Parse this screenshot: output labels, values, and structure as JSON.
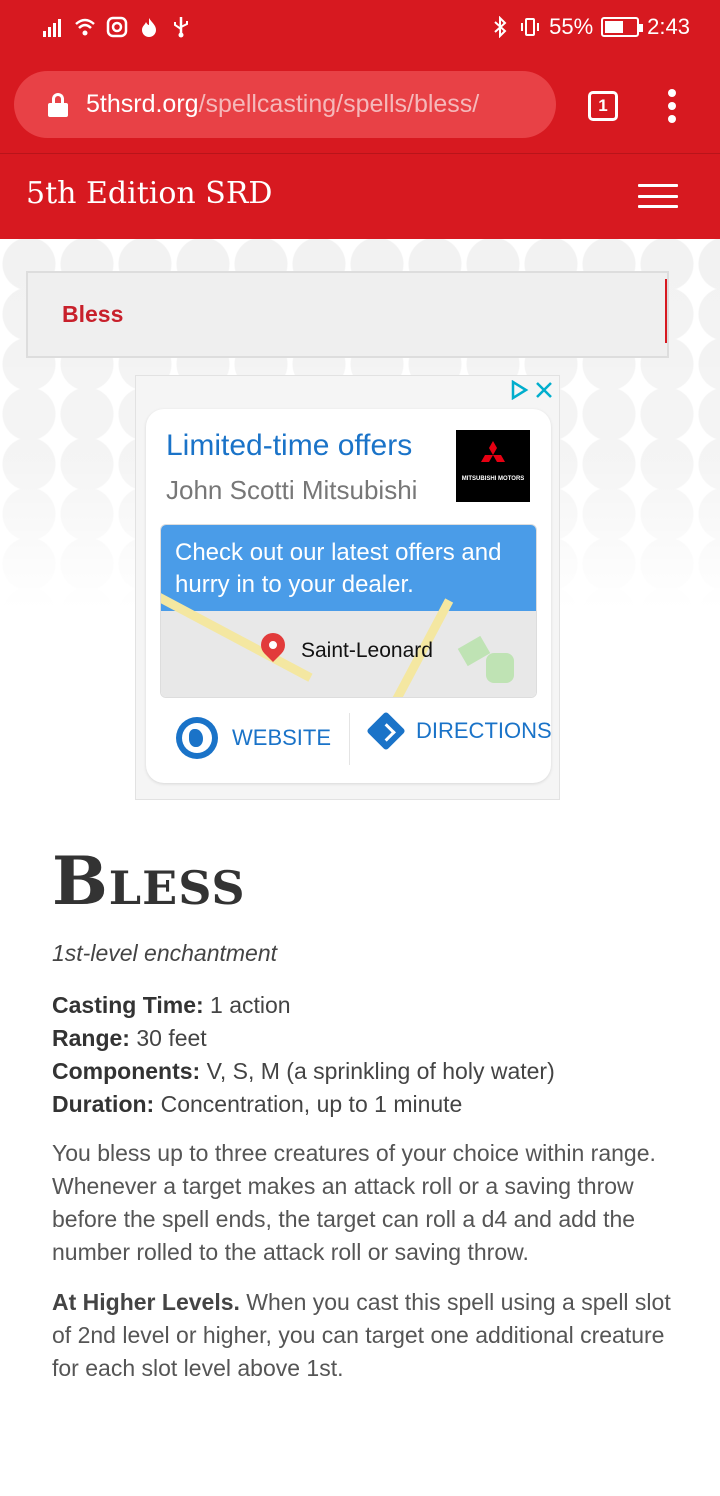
{
  "status_bar": {
    "battery": "55%",
    "time": "2:43",
    "icons": [
      "signal-icon",
      "wifi-icon",
      "instagram-icon",
      "flame-icon",
      "usb-icon",
      "bluetooth-icon",
      "vibrate-icon",
      "battery-icon"
    ]
  },
  "browser": {
    "url_domain": "5thsrd.org",
    "url_path": "/spellcasting/spells/bless/",
    "tab_count": "1"
  },
  "site": {
    "title": "5th Edition SRD"
  },
  "breadcrumb": {
    "label": "Bless"
  },
  "ad": {
    "headline": "Limited-time offers",
    "advertiser": "John Scotti Mitsubishi",
    "logo_text": "MITSUBISHI MOTORS",
    "body": "Check out our latest offers and hurry in to your dealer.",
    "map_label": "Saint-Leonard",
    "website_label": "WEBSITE",
    "directions_label": "DIRECTIONS",
    "colors": {
      "link": "#1a73c8",
      "panel": "#4a9ce8",
      "adchoices": "#00aecd"
    }
  },
  "spell": {
    "title": "Bless",
    "school": "1st-level enchantment",
    "casting_time_label": "Casting Time:",
    "casting_time": " 1 action",
    "range_label": "Range:",
    "range": " 30 feet",
    "components_label": "Components:",
    "components": " V, S, M (a sprinkling of holy water)",
    "duration_label": "Duration:",
    "duration": " Concentration, up to 1 minute",
    "description": "You bless up to three creatures of your choice within range. Whenever a target makes an attack roll or a saving throw before the spell ends, the target can roll a d4 and add the number rolled to the attack roll or saving throw.",
    "higher_levels_label": "At Higher Levels.",
    "higher_levels": " When you cast this spell using a spell slot of 2nd level or higher, you can target one additional creature for each slot level above 1st."
  },
  "theme": {
    "brand_red": "#d71920",
    "breadcrumb_red": "#c8202b"
  }
}
